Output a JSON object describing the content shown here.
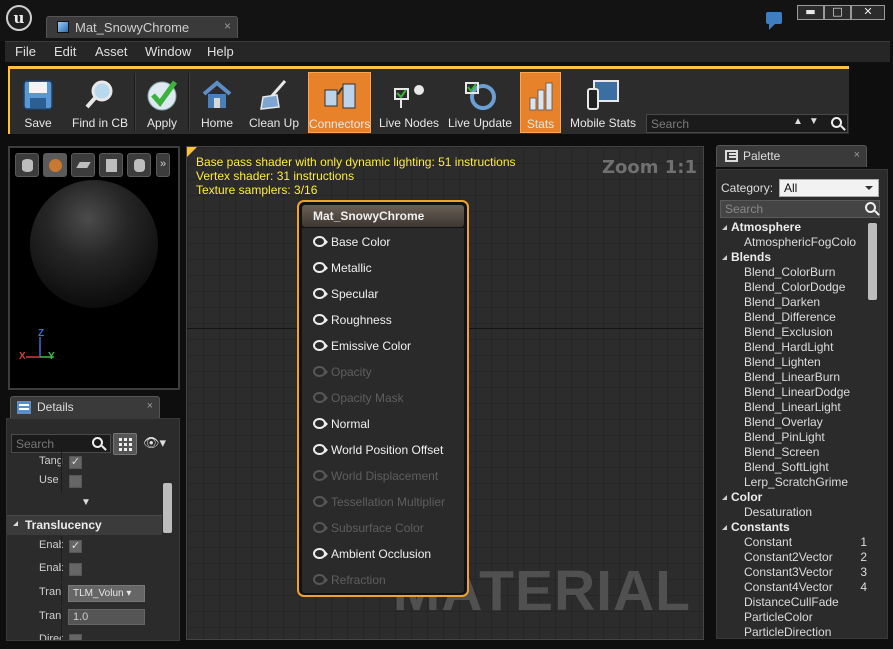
{
  "window": {
    "tab_title": "Mat_SnowyChrome",
    "tab_close": "×",
    "minimize": "▬",
    "maximize": "□",
    "close": "✕"
  },
  "menu": [
    "File",
    "Edit",
    "Asset",
    "Window",
    "Help"
  ],
  "toolbar": {
    "buttons": [
      {
        "label": "Save",
        "icon": "save-icon"
      },
      {
        "label": "Find in CB",
        "icon": "find-in-cb-icon"
      },
      {
        "label": "Apply",
        "icon": "apply-icon"
      },
      {
        "label": "Home",
        "icon": "home-icon"
      },
      {
        "label": "Clean Up",
        "icon": "clean-up-icon"
      },
      {
        "label": "Connectors",
        "icon": "connectors-icon",
        "active": true
      },
      {
        "label": "Live Nodes",
        "icon": "live-nodes-icon"
      },
      {
        "label": "Live Update",
        "icon": "live-update-icon"
      },
      {
        "label": "Stats",
        "icon": "stats-icon",
        "active": true
      },
      {
        "label": "Mobile Stats",
        "icon": "mobile-stats-icon"
      }
    ],
    "search_placeholder": "Search"
  },
  "viewport": {
    "axis_z": "Z",
    "axis_x": "X",
    "axis_y": "Y",
    "more": "»"
  },
  "details": {
    "tab_label": "Details",
    "tab_close": "×",
    "search_placeholder": "Search",
    "rows_top": [
      {
        "name": "Tang",
        "checked": true
      },
      {
        "name": "Use",
        "checked": false
      }
    ],
    "category": "Translucency",
    "rows": [
      {
        "name": "Enab",
        "type": "check",
        "checked": true
      },
      {
        "name": "Enab",
        "type": "check",
        "checked": false
      },
      {
        "name": "Tran",
        "type": "dropdown",
        "value": "TLM_Volun"
      },
      {
        "name": "Tran",
        "type": "number",
        "value": "1.0"
      },
      {
        "name": "Direc",
        "type": "check",
        "checked": false
      }
    ]
  },
  "graph": {
    "stats": [
      "Base pass shader with only dynamic lighting: 51 instructions",
      "Vertex shader: 31 instructions",
      "Texture samplers: 3/16"
    ],
    "zoom": "Zoom 1:1",
    "watermark": "MATERIAL",
    "node": {
      "title": "Mat_SnowyChrome",
      "pins": [
        {
          "label": "Base Color",
          "enabled": true
        },
        {
          "label": "Metallic",
          "enabled": true
        },
        {
          "label": "Specular",
          "enabled": true
        },
        {
          "label": "Roughness",
          "enabled": true
        },
        {
          "label": "Emissive Color",
          "enabled": true
        },
        {
          "label": "Opacity",
          "enabled": false
        },
        {
          "label": "Opacity Mask",
          "enabled": false
        },
        {
          "label": "Normal",
          "enabled": true
        },
        {
          "label": "World Position Offset",
          "enabled": true
        },
        {
          "label": "World Displacement",
          "enabled": false
        },
        {
          "label": "Tessellation Multiplier",
          "enabled": false
        },
        {
          "label": "Subsurface Color",
          "enabled": false
        },
        {
          "label": "Ambient Occlusion",
          "enabled": true
        },
        {
          "label": "Refraction",
          "enabled": false
        }
      ]
    }
  },
  "palette": {
    "tab_label": "Palette",
    "tab_close": "×",
    "category_label": "Category:",
    "category_value": "All",
    "search_placeholder": "Search",
    "list": [
      {
        "kind": "cat",
        "label": "Atmosphere"
      },
      {
        "kind": "item",
        "label": "AtmosphericFogColo"
      },
      {
        "kind": "cat",
        "label": "Blends"
      },
      {
        "kind": "item",
        "label": "Blend_ColorBurn"
      },
      {
        "kind": "item",
        "label": "Blend_ColorDodge"
      },
      {
        "kind": "item",
        "label": "Blend_Darken"
      },
      {
        "kind": "item",
        "label": "Blend_Difference"
      },
      {
        "kind": "item",
        "label": "Blend_Exclusion"
      },
      {
        "kind": "item",
        "label": "Blend_HardLight"
      },
      {
        "kind": "item",
        "label": "Blend_Lighten"
      },
      {
        "kind": "item",
        "label": "Blend_LinearBurn"
      },
      {
        "kind": "item",
        "label": "Blend_LinearDodge"
      },
      {
        "kind": "item",
        "label": "Blend_LinearLight"
      },
      {
        "kind": "item",
        "label": "Blend_Overlay"
      },
      {
        "kind": "item",
        "label": "Blend_PinLight"
      },
      {
        "kind": "item",
        "label": "Blend_Screen"
      },
      {
        "kind": "item",
        "label": "Blend_SoftLight"
      },
      {
        "kind": "item",
        "label": "Lerp_ScratchGrime"
      },
      {
        "kind": "cat",
        "label": "Color"
      },
      {
        "kind": "item",
        "label": "Desaturation"
      },
      {
        "kind": "cat",
        "label": "Constants"
      },
      {
        "kind": "item",
        "label": "Constant",
        "hotkey": "1"
      },
      {
        "kind": "item",
        "label": "Constant2Vector",
        "hotkey": "2"
      },
      {
        "kind": "item",
        "label": "Constant3Vector",
        "hotkey": "3"
      },
      {
        "kind": "item",
        "label": "Constant4Vector",
        "hotkey": "4"
      },
      {
        "kind": "item",
        "label": "DistanceCullFade"
      },
      {
        "kind": "item",
        "label": "ParticleColor"
      },
      {
        "kind": "item",
        "label": "ParticleDirection"
      }
    ]
  },
  "colors": {
    "accent": "#ffc13a",
    "active_button": "#e8822a",
    "stats_text": "#ffee33",
    "node_border": "#f0a230"
  }
}
